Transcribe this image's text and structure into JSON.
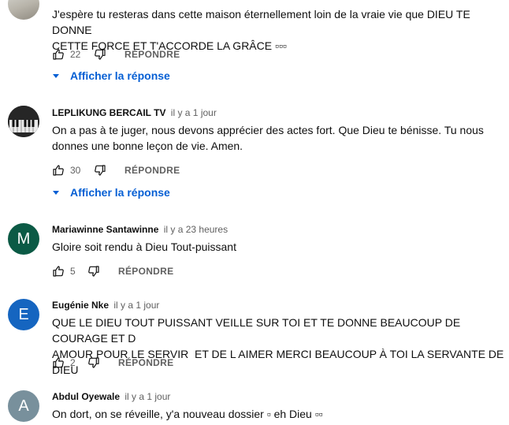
{
  "comments": [
    {
      "text": "J'espère tu resteras dans cette maison éternellement loin de la vraie vie que DIEU TE DONNE\nCETTE FORCE ET T'ACCORDE LA GRÂCE ▫▫▫",
      "likes": "22",
      "reply_label": "RÉPONDRE",
      "show_replies": "Afficher la réponse"
    },
    {
      "author": "LEPLIKUNG BERCAIL TV",
      "time": "il y a 1 jour",
      "text": "On a pas à te juger, nous devons apprécier des actes fort. Que Dieu te bénisse. Tu nous\ndonnes une bonne leçon de vie. Amen.",
      "likes": "30",
      "reply_label": "RÉPONDRE",
      "show_replies": "Afficher la réponse"
    },
    {
      "author": "Mariawinne Santawinne",
      "time": "il y a 23 heures",
      "avatar_letter": "M",
      "avatar_color": "#0b5a45",
      "text": "Gloire soit rendu à Dieu Tout-puissant",
      "likes": "5",
      "reply_label": "RÉPONDRE"
    },
    {
      "author": "Eugénie Nke",
      "time": "il y a 1 jour",
      "avatar_letter": "E",
      "avatar_color": "#1565c0",
      "text": "QUE LE DIEU TOUT PUISSANT VEILLE SUR TOI ET TE DONNE BEAUCOUP DE COURAGE ET D\nAMOUR POUR LE SERVIR  ET DE L AIMER MERCI BEAUCOUP À TOI LA SERVANTE DE DIEU",
      "likes": "2",
      "reply_label": "RÉPONDRE"
    },
    {
      "author": "Abdul Oyewale",
      "time": "il y a 1 jour",
      "avatar_letter": "A",
      "avatar_color": "#78909c",
      "text": "On dort, on se réveille, y'a nouveau dossier ▫ eh Dieu ▫▫"
    }
  ]
}
